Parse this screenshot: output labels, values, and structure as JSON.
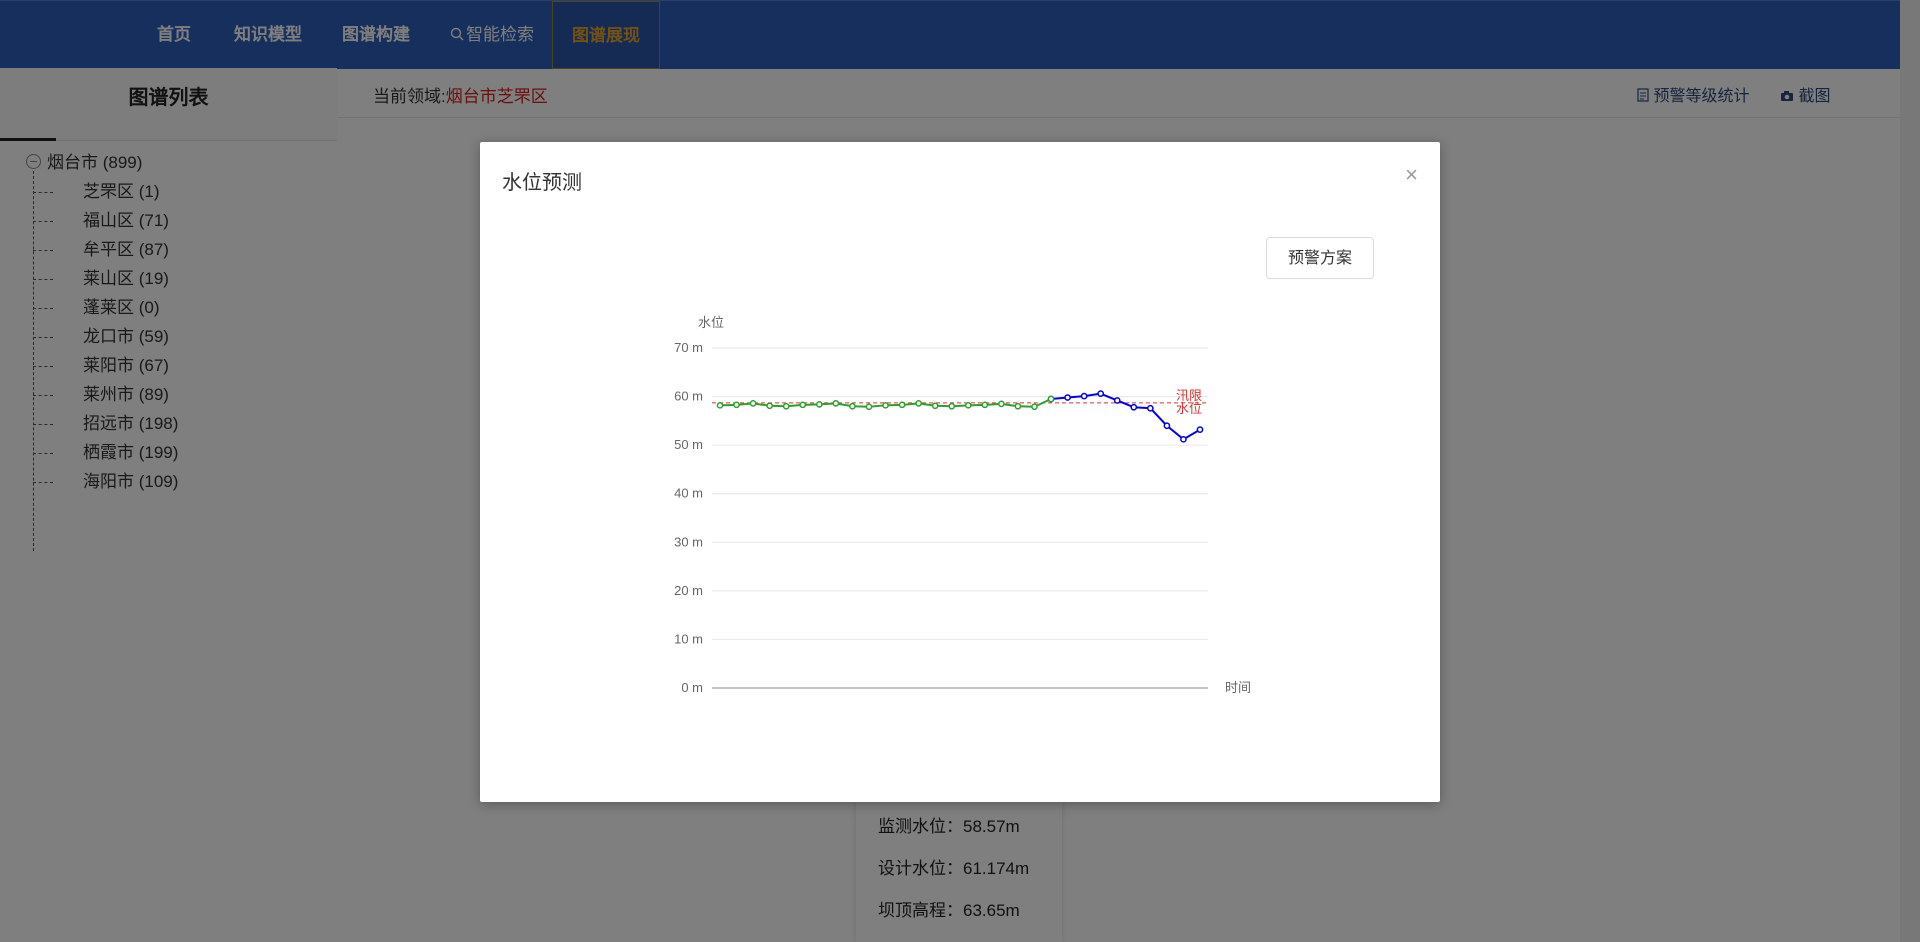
{
  "nav": {
    "items": [
      {
        "label": "首页"
      },
      {
        "label": "知识模型"
      },
      {
        "label": "图谱构建"
      },
      {
        "label": "智能检索"
      },
      {
        "label": "图谱展现"
      }
    ],
    "active_index": 4
  },
  "sidebar": {
    "title": "图谱列表",
    "root": "烟台市 (899)",
    "items": [
      {
        "label": "芝罘区 (1)"
      },
      {
        "label": "福山区 (71)"
      },
      {
        "label": "牟平区 (87)"
      },
      {
        "label": "莱山区 (19)"
      },
      {
        "label": "蓬莱区 (0)"
      },
      {
        "label": "龙口市 (59)"
      },
      {
        "label": "莱阳市 (67)"
      },
      {
        "label": "莱州市 (89)"
      },
      {
        "label": "招远市 (198)"
      },
      {
        "label": "栖霞市 (199)"
      },
      {
        "label": "海阳市 (109)"
      }
    ]
  },
  "content": {
    "domain_label": "当前领域:",
    "domain_value": "烟台市芝罘区",
    "links": {
      "stats": "预警等级统计",
      "screenshot": "截图"
    }
  },
  "info_card": {
    "rows": [
      {
        "label": "监测水位：58.57m"
      },
      {
        "label": "设计水位：61.174m"
      },
      {
        "label": "坝顶高程：63.65m"
      }
    ]
  },
  "modal": {
    "title": "水位预测",
    "close_symbol": "×",
    "warn_button": "预警方案"
  },
  "colors": {
    "nav_bg": "#2f5fb8",
    "nav_active_text": "#e2a32a",
    "observed_line": "#2ca02c",
    "predicted_line": "#0000ee",
    "flood_limit": "#e23030",
    "domain_red": "#d01f1f"
  },
  "chart_data": {
    "type": "line",
    "ylabel": "水位",
    "xlabel": "时间",
    "ylim": [
      0,
      70
    ],
    "y_ticks": [
      "0 m",
      "10 m",
      "20 m",
      "30 m",
      "40 m",
      "50 m",
      "60 m",
      "70 m"
    ],
    "y_tick_values": [
      0,
      10,
      20,
      30,
      40,
      50,
      60,
      70
    ],
    "grid": true,
    "series": [
      {
        "role": "observed",
        "values": [
          58.2,
          58.3,
          58.6,
          58.1,
          58.0,
          58.3,
          58.4,
          58.6,
          58.0,
          57.9,
          58.2,
          58.3,
          58.6,
          58.1,
          58.0,
          58.2,
          58.3,
          58.5,
          58.0,
          57.9,
          59.5
        ],
        "x_start": 0
      },
      {
        "role": "predicted",
        "values": [
          59.5,
          59.8,
          60.1,
          60.6,
          59.2,
          57.8,
          57.6,
          54.0,
          51.2,
          53.2
        ],
        "x_start": 20
      }
    ],
    "reference_lines": [
      {
        "label_line1": "汛限",
        "label_line2": "水位",
        "value": 58.7
      }
    ],
    "n_points": 30
  }
}
